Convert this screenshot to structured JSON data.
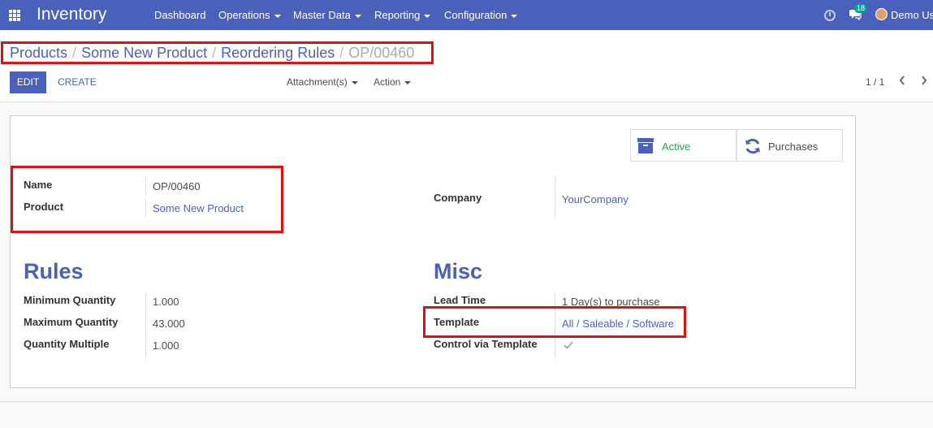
{
  "navbar": {
    "app_name": "Inventory",
    "menus": [
      {
        "label": "Dashboard",
        "dropdown": false
      },
      {
        "label": "Operations",
        "dropdown": true
      },
      {
        "label": "Master Data",
        "dropdown": true
      },
      {
        "label": "Reporting",
        "dropdown": true
      },
      {
        "label": "Configuration",
        "dropdown": true
      }
    ],
    "chat_count": "18",
    "user_name": "Demo Us",
    "bg_color": "#4a61bb"
  },
  "breadcrumb": {
    "items": [
      "Products",
      "Some New Product",
      "Reordering Rules"
    ],
    "current": "OP/00460"
  },
  "toolbar": {
    "edit_label": "EDIT",
    "create_label": "CREATE",
    "attachments_label": "Attachment(s)",
    "action_label": "Action",
    "pager": "1 / 1"
  },
  "smart_buttons": {
    "active_label": "Active",
    "active_color": "#28a745",
    "purchases_label": "Purchases"
  },
  "form": {
    "name_label": "Name",
    "name_value": "OP/00460",
    "product_label": "Product",
    "product_value": "Some New Product",
    "company_label": "Company",
    "company_value": "YourCompany",
    "rules_title": "Rules",
    "min_qty_label": "Minimum Quantity",
    "min_qty_value": "1.000",
    "max_qty_label": "Maximum Quantity",
    "max_qty_value": "43.000",
    "qty_multiple_label": "Quantity Multiple",
    "qty_multiple_value": "1.000",
    "misc_title": "Misc",
    "lead_time_label": "Lead Time",
    "lead_time_value": "1  Day(s) to purchase",
    "template_label": "Template",
    "template_value": "All / Saleable / Software",
    "control_template_label": "Control via Template",
    "control_template_checked": true
  },
  "highlight_color": "#e01010"
}
